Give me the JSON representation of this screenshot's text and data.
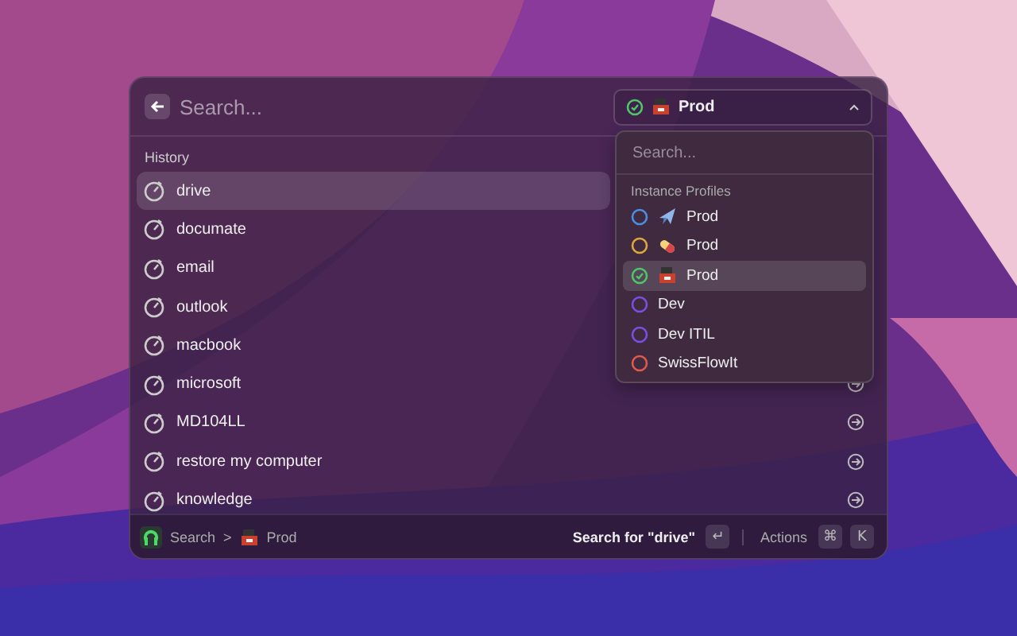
{
  "search": {
    "placeholder": "Search..."
  },
  "profile_button": {
    "label": "Prod"
  },
  "section_title": "History",
  "history": [
    {
      "label": "drive",
      "selected": true,
      "show_arrow": false
    },
    {
      "label": "documate",
      "selected": false,
      "show_arrow": false
    },
    {
      "label": "email",
      "selected": false,
      "show_arrow": false
    },
    {
      "label": "outlook",
      "selected": false,
      "show_arrow": false
    },
    {
      "label": "macbook",
      "selected": false,
      "show_arrow": false
    },
    {
      "label": "microsoft",
      "selected": false,
      "show_arrow": true
    },
    {
      "label": "MD104LL",
      "selected": false,
      "show_arrow": true
    },
    {
      "label": "restore my computer",
      "selected": false,
      "show_arrow": true
    },
    {
      "label": "knowledge",
      "selected": false,
      "show_arrow": true
    }
  ],
  "dropdown": {
    "placeholder": "Search...",
    "section_title": "Instance Profiles",
    "profiles": [
      {
        "kind": "plane",
        "label": "Prod",
        "color": "#4a90e2",
        "selected": false
      },
      {
        "kind": "pill",
        "label": "Prod",
        "color": "#e0a83a",
        "selected": false
      },
      {
        "kind": "machine",
        "label": "Prod",
        "color": "#4cc76a",
        "selected": true
      },
      {
        "kind": "plain",
        "label": "Dev",
        "color": "#7b4fe0",
        "selected": false
      },
      {
        "kind": "plain",
        "label": "Dev ITIL",
        "color": "#7b4fe0",
        "selected": false
      },
      {
        "kind": "plain",
        "label": "SwissFlowIt",
        "color": "#e05a4a",
        "selected": false
      }
    ]
  },
  "footer": {
    "breadcrumb_root": "Search",
    "breadcrumb_separator": ">",
    "breadcrumb_current": "Prod",
    "primary_action": "Search for \"drive\"",
    "primary_key": "↵",
    "actions_label": "Actions",
    "action_keys": [
      "⌘",
      "K"
    ]
  }
}
